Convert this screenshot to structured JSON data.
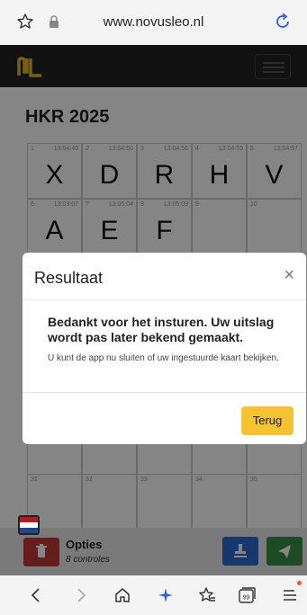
{
  "browser": {
    "url": "www.novusleo.nl"
  },
  "page": {
    "title": "HKR 2025"
  },
  "grid": {
    "row1": [
      {
        "num": "1",
        "time": "13:04:49",
        "letter": "X"
      },
      {
        "num": "2",
        "time": "13:04:50",
        "letter": "D"
      },
      {
        "num": "3",
        "time": "13:04:56",
        "letter": "R"
      },
      {
        "num": "4",
        "time": "13:04:59",
        "letter": "H"
      },
      {
        "num": "5",
        "time": "13:04:57",
        "letter": "V"
      }
    ],
    "row2": [
      {
        "num": "6",
        "time": "13:03:07",
        "letter": "A"
      },
      {
        "num": "7",
        "time": "13:05:04",
        "letter": "E"
      },
      {
        "num": "8",
        "time": "13:05:09",
        "letter": "F"
      },
      {
        "num": "9",
        "time": "",
        "letter": ""
      },
      {
        "num": "10",
        "time": "",
        "letter": ""
      }
    ],
    "row_last": [
      {
        "num": "31"
      },
      {
        "num": "32"
      },
      {
        "num": "33"
      },
      {
        "num": "34"
      },
      {
        "num": "35"
      }
    ]
  },
  "modal": {
    "title": "Resultaat",
    "close": "×",
    "bold_text": "Bedankt voor het insturen. Uw uitslag wordt pas later bekend gemaakt.",
    "text": "U kunt de app nu sluiten of uw ingestuurde kaart bekijken.",
    "button": "Terug"
  },
  "footer": {
    "options_title": "Opties",
    "options_sub": "8 controles"
  },
  "colors": {
    "accent_yellow": "#f5c232",
    "danger": "#c03b3b",
    "primary": "#2d6bcf",
    "success": "#3a8f45"
  },
  "icons": {
    "star": "star-icon",
    "lock": "lock-icon",
    "reload": "reload-icon",
    "back": "back-icon",
    "forward": "forward-icon",
    "home": "home-icon",
    "sparkle": "sparkle-icon",
    "favorites": "favorites-icon",
    "tabs": "tabs-icon",
    "menu": "menu-icon"
  },
  "nav": {
    "tabs_count": "99"
  }
}
